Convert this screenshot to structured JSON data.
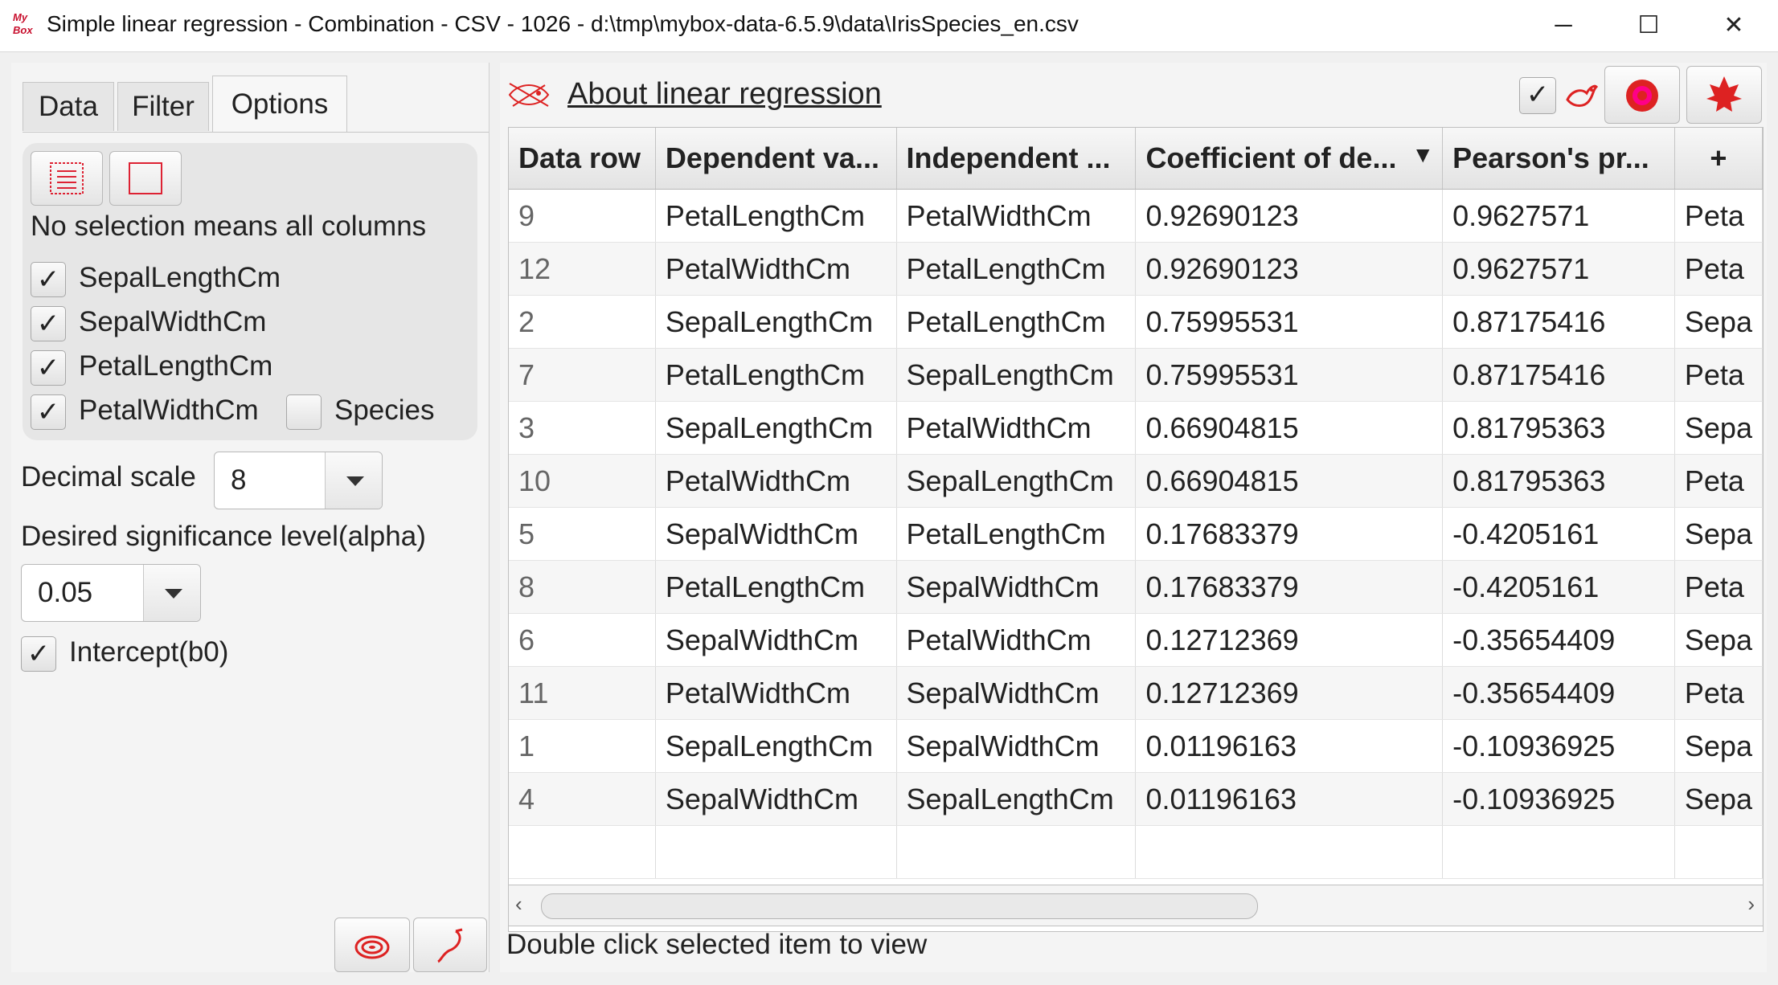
{
  "window": {
    "app_icon_text": "My Box",
    "title": "Simple linear regression - Combination - CSV - 1026 - d:\\tmp\\mybox-data-6.5.9\\data\\IrisSpecies_en.csv",
    "minimize_glyph": "─",
    "maximize_glyph": "☐",
    "close_glyph": "✕"
  },
  "left_panel": {
    "tabs": [
      {
        "label": "Data"
      },
      {
        "label": "Filter"
      },
      {
        "label": "Options"
      }
    ],
    "active_tab": "Options",
    "select_all_icon": "select-all-icon",
    "select_none_icon": "select-none-icon",
    "hint": "No selection means all columns",
    "columns": [
      {
        "label": "SepalLengthCm",
        "checked": true
      },
      {
        "label": "SepalWidthCm",
        "checked": true
      },
      {
        "label": "PetalLengthCm",
        "checked": true
      },
      {
        "label": "PetalWidthCm",
        "checked": true
      },
      {
        "label": "Species",
        "checked": false
      }
    ],
    "check_glyph": "✓",
    "decimal_scale_label": "Decimal scale",
    "decimal_scale_value": "8",
    "alpha_label": "Desired significance level(alpha)",
    "alpha_value": "0.05",
    "intercept_label": "Intercept(b0)",
    "intercept_checked": true
  },
  "right_panel": {
    "about_link": "About linear regression",
    "status": "Double click selected item to view",
    "table": {
      "headers": [
        "Data row",
        "Dependent va...",
        "Independent ...",
        "Coefficient of de...",
        "Pearson's pr...",
        "+"
      ],
      "sort_indicator": "▼",
      "rows": [
        [
          "9",
          "PetalLengthCm",
          "PetalWidthCm",
          "0.92690123",
          "0.9627571",
          "Peta"
        ],
        [
          "12",
          "PetalWidthCm",
          "PetalLengthCm",
          "0.92690123",
          "0.9627571",
          "Peta"
        ],
        [
          "2",
          "SepalLengthCm",
          "PetalLengthCm",
          "0.75995531",
          "0.87175416",
          "Sepa"
        ],
        [
          "7",
          "PetalLengthCm",
          "SepalLengthCm",
          "0.75995531",
          "0.87175416",
          "Peta"
        ],
        [
          "3",
          "SepalLengthCm",
          "PetalWidthCm",
          "0.66904815",
          "0.81795363",
          "Sepa"
        ],
        [
          "10",
          "PetalWidthCm",
          "SepalLengthCm",
          "0.66904815",
          "0.81795363",
          "Peta"
        ],
        [
          "5",
          "SepalWidthCm",
          "PetalLengthCm",
          "0.17683379",
          "-0.4205161",
          "Sepa"
        ],
        [
          "8",
          "PetalLengthCm",
          "SepalWidthCm",
          "0.17683379",
          "-0.4205161",
          "Peta"
        ],
        [
          "6",
          "SepalWidthCm",
          "PetalWidthCm",
          "0.12712369",
          "-0.35654409",
          "Sepa"
        ],
        [
          "11",
          "PetalWidthCm",
          "SepalWidthCm",
          "0.12712369",
          "-0.35654409",
          "Peta"
        ],
        [
          "1",
          "SepalLengthCm",
          "SepalWidthCm",
          "0.01196163",
          "-0.10936925",
          "Sepa"
        ],
        [
          "4",
          "SepalWidthCm",
          "SepalLengthCm",
          "0.01196163",
          "-0.10936925",
          "Sepa"
        ]
      ]
    }
  },
  "colors": {
    "accent_red": "#c8102e",
    "title_bar": "#ffffff",
    "panel_bg": "#f4f4f4"
  }
}
